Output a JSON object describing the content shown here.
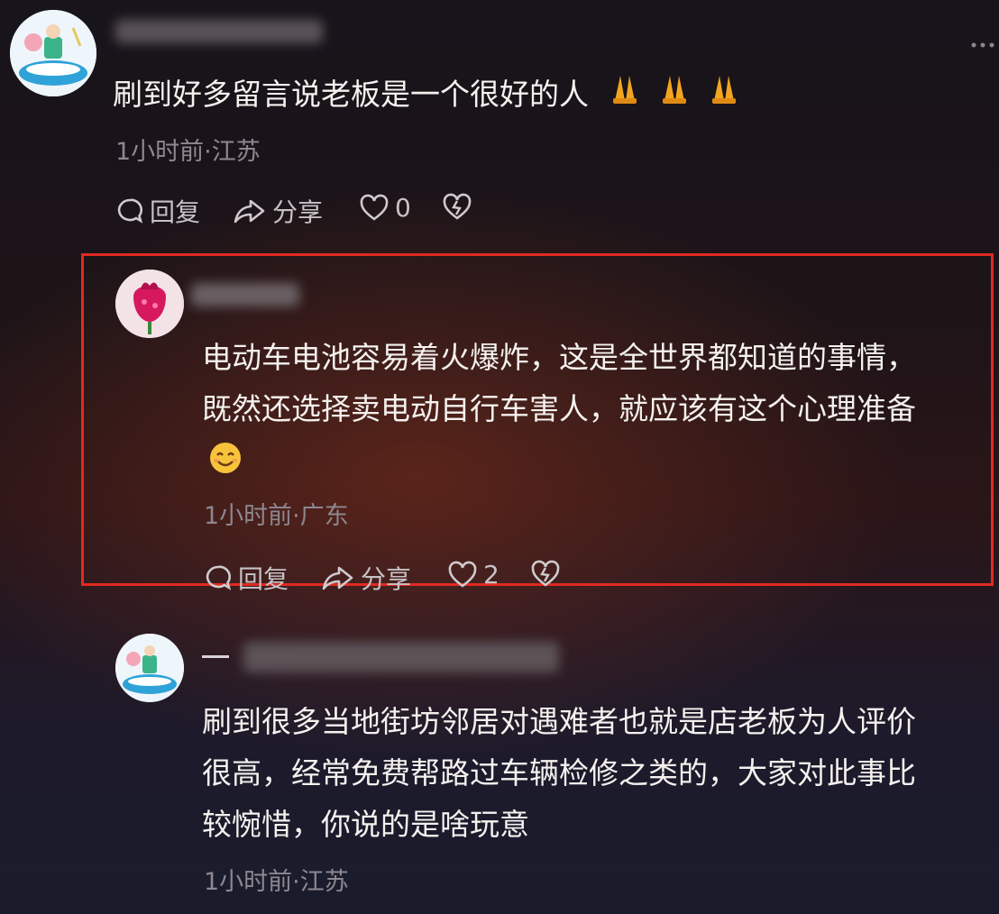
{
  "comments": [
    {
      "text": "刷到好多留言说老板是一个很好的人",
      "emojis": [
        "folded-hands",
        "folded-hands",
        "folded-hands"
      ],
      "meta": "1小时前·江苏",
      "actions": {
        "reply": "回复",
        "share": "分享",
        "likes": "0"
      }
    },
    {
      "line1": "电动车电池容易着火爆炸，这是全世界都知道的事情，",
      "line2": "既然还选择卖电动自行车害人，就应该有这个心理准备",
      "emoji": "smiling-face",
      "meta": "1小时前·广东",
      "actions": {
        "reply": "回复",
        "share": "分享",
        "likes": "2"
      },
      "highlighted": true
    },
    {
      "line1": "刷到很多当地街坊邻居对遇难者也就是店老板为人评价",
      "line2": "很高，经常免费帮路过车辆检修之类的，大家对此事比",
      "line3": "较惋惜，你说的是啥玩意",
      "meta": "1小时前·江苏"
    }
  ],
  "colors": {
    "highlight_border": "#e02a22",
    "meta_text": "#8d8790"
  },
  "icons": [
    "more-icon",
    "comment-icon",
    "share-icon",
    "heart-icon",
    "dislike-heart-icon"
  ]
}
